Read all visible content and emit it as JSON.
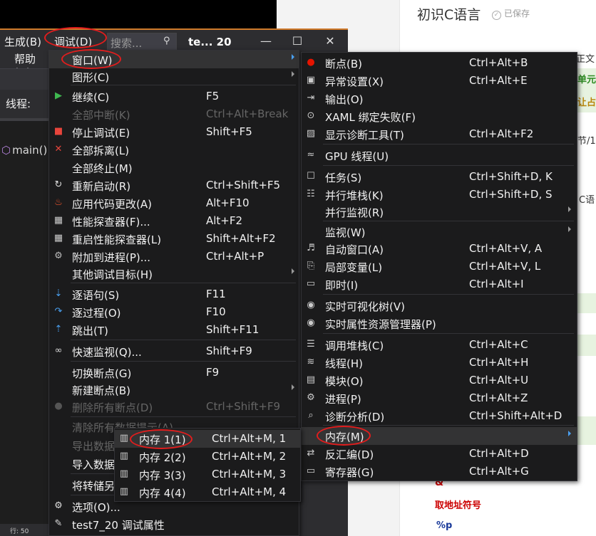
{
  "editor": {
    "title": "初识C语言",
    "saved": "已保存",
    "peek": [
      "正文",
      "单元",
      "让占一",
      "节/1",
      "C语"
    ],
    "content": {
      "amp": "&",
      "addr_op": "取地址符号",
      "fmt_p": "%p"
    }
  },
  "vs": {
    "menubar": [
      {
        "label": "生成(B)"
      },
      {
        "label": "调试(D)"
      }
    ],
    "search_placeholder": "搜索...",
    "tab_label": "te... 20",
    "help_menu": "帮助(H)",
    "thread_label": "线程:",
    "code_fn": "main()",
    "status": "行: 50"
  },
  "debug_menu": {
    "items": [
      {
        "label": "窗口(W)",
        "icon": "",
        "shortcut": "",
        "submenu": true,
        "state": "highlighted"
      },
      {
        "label": "图形(C)",
        "icon": "",
        "shortcut": "",
        "submenu": true
      },
      {
        "label": "继续(C)",
        "icon": "play-icon",
        "shortcut": "F5"
      },
      {
        "label": "全部中断(K)",
        "icon": "",
        "shortcut": "Ctrl+Alt+Break",
        "state": "disabled"
      },
      {
        "label": "停止调试(E)",
        "icon": "stop-icon",
        "shortcut": "Shift+F5"
      },
      {
        "label": "全部拆离(L)",
        "icon": "detach-icon",
        "shortcut": ""
      },
      {
        "label": "全部终止(M)",
        "icon": "",
        "shortcut": ""
      },
      {
        "label": "重新启动(R)",
        "icon": "restart-icon",
        "shortcut": "Ctrl+Shift+F5"
      },
      {
        "label": "应用代码更改(A)",
        "icon": "flame-icon",
        "shortcut": "Alt+F10"
      },
      {
        "label": "性能探查器(F)...",
        "icon": "profiler-icon",
        "shortcut": "Alt+F2"
      },
      {
        "label": "重启性能探查器(L)",
        "icon": "profiler-restart-icon",
        "shortcut": "Shift+Alt+F2"
      },
      {
        "label": "附加到进程(P)...",
        "icon": "attach-icon",
        "shortcut": "Ctrl+Alt+P"
      },
      {
        "label": "其他调试目标(H)",
        "icon": "",
        "shortcut": "",
        "submenu": true
      },
      {
        "label": "逐语句(S)",
        "icon": "step-into-icon",
        "shortcut": "F11"
      },
      {
        "label": "逐过程(O)",
        "icon": "step-over-icon",
        "shortcut": "F10"
      },
      {
        "label": "跳出(T)",
        "icon": "step-out-icon",
        "shortcut": "Shift+F11"
      },
      {
        "label": "快速监视(Q)...",
        "icon": "glasses-icon",
        "shortcut": "Shift+F9"
      },
      {
        "label": "切换断点(G)",
        "icon": "",
        "shortcut": "F9"
      },
      {
        "label": "新建断点(B)",
        "icon": "",
        "shortcut": "",
        "submenu": true
      },
      {
        "label": "删除所有断点(D)",
        "icon": "delete-breakpoints-icon",
        "shortcut": "Ctrl+Shift+F9",
        "state": "disabled"
      },
      {
        "label": "清除所有数据提示(A)",
        "icon": "",
        "shortcut": "",
        "state": "disabled"
      },
      {
        "label": "导出数据提示(X)...",
        "icon": "",
        "shortcut": "",
        "state": "disabled"
      },
      {
        "label": "导入数据提示(P)...",
        "icon": "",
        "shortcut": ""
      },
      {
        "label": "将转储另存为(V)...",
        "icon": "",
        "shortcut": ""
      },
      {
        "label": "选项(O)...",
        "icon": "gear-icon",
        "shortcut": ""
      },
      {
        "label": "test7_20 调试属性",
        "icon": "wrench-icon",
        "shortcut": ""
      }
    ]
  },
  "window_menu": {
    "items": [
      {
        "label": "断点(B)",
        "icon": "breakpoint-dot-icon",
        "shortcut": "Ctrl+Alt+B"
      },
      {
        "label": "异常设置(X)",
        "icon": "exception-settings-icon",
        "shortcut": "Ctrl+Alt+E"
      },
      {
        "label": "输出(O)",
        "icon": "output-icon",
        "shortcut": ""
      },
      {
        "label": "XAML 绑定失败(F)",
        "icon": "xaml-binding-icon",
        "shortcut": ""
      },
      {
        "label": "显示诊断工具(T)",
        "icon": "diagnostic-tools-icon",
        "shortcut": "Ctrl+Alt+F2"
      },
      {
        "label": "GPU 线程(U)",
        "icon": "gpu-threads-icon",
        "shortcut": ""
      },
      {
        "label": "任务(S)",
        "icon": "tasks-icon",
        "shortcut": "Ctrl+Shift+D, K"
      },
      {
        "label": "并行堆栈(K)",
        "icon": "parallel-stacks-icon",
        "shortcut": "Ctrl+Shift+D, S"
      },
      {
        "label": "并行监视(R)",
        "icon": "",
        "shortcut": "",
        "submenu": true
      },
      {
        "label": "监视(W)",
        "icon": "",
        "shortcut": "",
        "submenu": true
      },
      {
        "label": "自动窗口(A)",
        "icon": "autos-icon",
        "shortcut": "Ctrl+Alt+V, A"
      },
      {
        "label": "局部变量(L)",
        "icon": "locals-icon",
        "shortcut": "Ctrl+Alt+V, L"
      },
      {
        "label": "即时(I)",
        "icon": "immediate-icon",
        "shortcut": "Ctrl+Alt+I"
      },
      {
        "label": "实时可视化树(V)",
        "icon": "camera-icon",
        "shortcut": ""
      },
      {
        "label": "实时属性资源管理器(P)",
        "icon": "camera-icon",
        "shortcut": ""
      },
      {
        "label": "调用堆栈(C)",
        "icon": "call-stack-icon",
        "shortcut": "Ctrl+Alt+C"
      },
      {
        "label": "线程(H)",
        "icon": "threads-icon",
        "shortcut": "Ctrl+Alt+H"
      },
      {
        "label": "模块(O)",
        "icon": "modules-icon",
        "shortcut": "Ctrl+Alt+U"
      },
      {
        "label": "进程(P)",
        "icon": "processes-icon",
        "shortcut": "Ctrl+Alt+Z"
      },
      {
        "label": "诊断分析(D)",
        "icon": "diagnostic-analysis-icon",
        "shortcut": "Ctrl+Shift+Alt+D"
      },
      {
        "label": "内存(M)",
        "icon": "",
        "shortcut": "",
        "submenu": true,
        "state": "highlighted"
      },
      {
        "label": "反汇编(D)",
        "icon": "disassembly-icon",
        "shortcut": "Ctrl+Alt+D"
      },
      {
        "label": "寄存器(G)",
        "icon": "registers-icon",
        "shortcut": "Ctrl+Alt+G"
      }
    ]
  },
  "memory_menu": {
    "items": [
      {
        "label": "内存 1(1)",
        "icon": "memory-chip-icon",
        "shortcut": "Ctrl+Alt+M, 1",
        "state": "highlighted"
      },
      {
        "label": "内存 2(2)",
        "icon": "memory-chip-icon",
        "shortcut": "Ctrl+Alt+M, 2"
      },
      {
        "label": "内存 3(3)",
        "icon": "memory-chip-icon",
        "shortcut": "Ctrl+Alt+M, 3"
      },
      {
        "label": "内存 4(4)",
        "icon": "memory-chip-icon",
        "shortcut": "Ctrl+Alt+M, 4"
      }
    ]
  },
  "colors": {
    "menu_bg": "#1b1b1c",
    "menu_text": "#f1f1f1",
    "disabled_text": "#656565",
    "accent_highlight": "#333334",
    "annotation_red": "#e21d1d",
    "vs_border_orange": "#d07a2a",
    "breakpoint_red": "#e51400",
    "continue_green": "#3fb950"
  }
}
